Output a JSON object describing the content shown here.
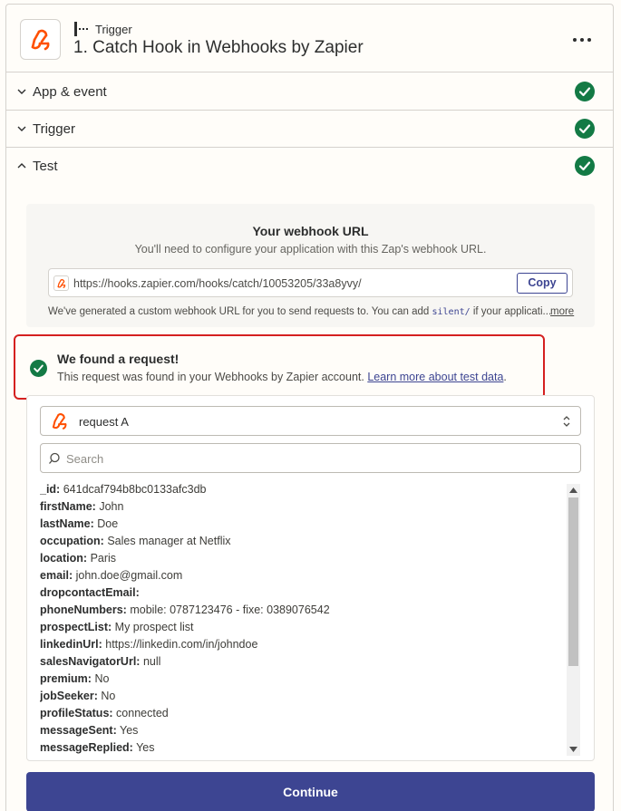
{
  "header": {
    "step_kind": "Trigger",
    "title": "1. Catch Hook in Webhooks by Zapier",
    "brand_color": "#ff4f00"
  },
  "sections": [
    {
      "label": "App & event",
      "state": "collapsed",
      "status": "complete"
    },
    {
      "label": "Trigger",
      "state": "collapsed",
      "status": "complete"
    },
    {
      "label": "Test",
      "state": "expanded",
      "status": "complete"
    }
  ],
  "webhook": {
    "title": "Your webhook URL",
    "subtitle": "You'll need to configure your application with this Zap's webhook URL.",
    "url": "https://hooks.zapier.com/hooks/catch/10053205/33a8yvy/",
    "copy_label": "Copy",
    "note_prefix": "We've generated a custom webhook URL for you to send requests to. You can add ",
    "note_code": "silent/",
    "note_suffix": " if your applicati...",
    "more_label": "more"
  },
  "found": {
    "title": "We found a request!",
    "text": "This request was found in your Webhooks by Zapier account. ",
    "link": "Learn more about test data",
    "text_end": "."
  },
  "request": {
    "selected": "request A",
    "search_placeholder": "Search",
    "fields": [
      {
        "key": "_id:",
        "value": "641dcaf794b8bc0133afc3db"
      },
      {
        "key": "firstName:",
        "value": "John"
      },
      {
        "key": "lastName:",
        "value": "Doe"
      },
      {
        "key": "occupation:",
        "value": "Sales manager at Netflix"
      },
      {
        "key": "location:",
        "value": "Paris"
      },
      {
        "key": "email:",
        "value": "john.doe@gmail.com"
      },
      {
        "key": "dropcontactEmail:",
        "value": ""
      },
      {
        "key": "phoneNumbers:",
        "value": "mobile: 0787123476 - fixe: 0389076542"
      },
      {
        "key": "prospectList:",
        "value": "My prospect list"
      },
      {
        "key": "linkedinUrl:",
        "value": "https://linkedin.com/in/johndoe"
      },
      {
        "key": "salesNavigatorUrl:",
        "value": "null"
      },
      {
        "key": "premium:",
        "value": "No"
      },
      {
        "key": "jobSeeker:",
        "value": "No"
      },
      {
        "key": "profileStatus:",
        "value": "connected"
      },
      {
        "key": "messageSent:",
        "value": "Yes"
      },
      {
        "key": "messageReplied:",
        "value": "Yes"
      }
    ]
  },
  "footer": {
    "continue_label": "Continue"
  },
  "colors": {
    "accent": "#3d4592",
    "success": "#137a45",
    "highlight": "#d52020"
  }
}
